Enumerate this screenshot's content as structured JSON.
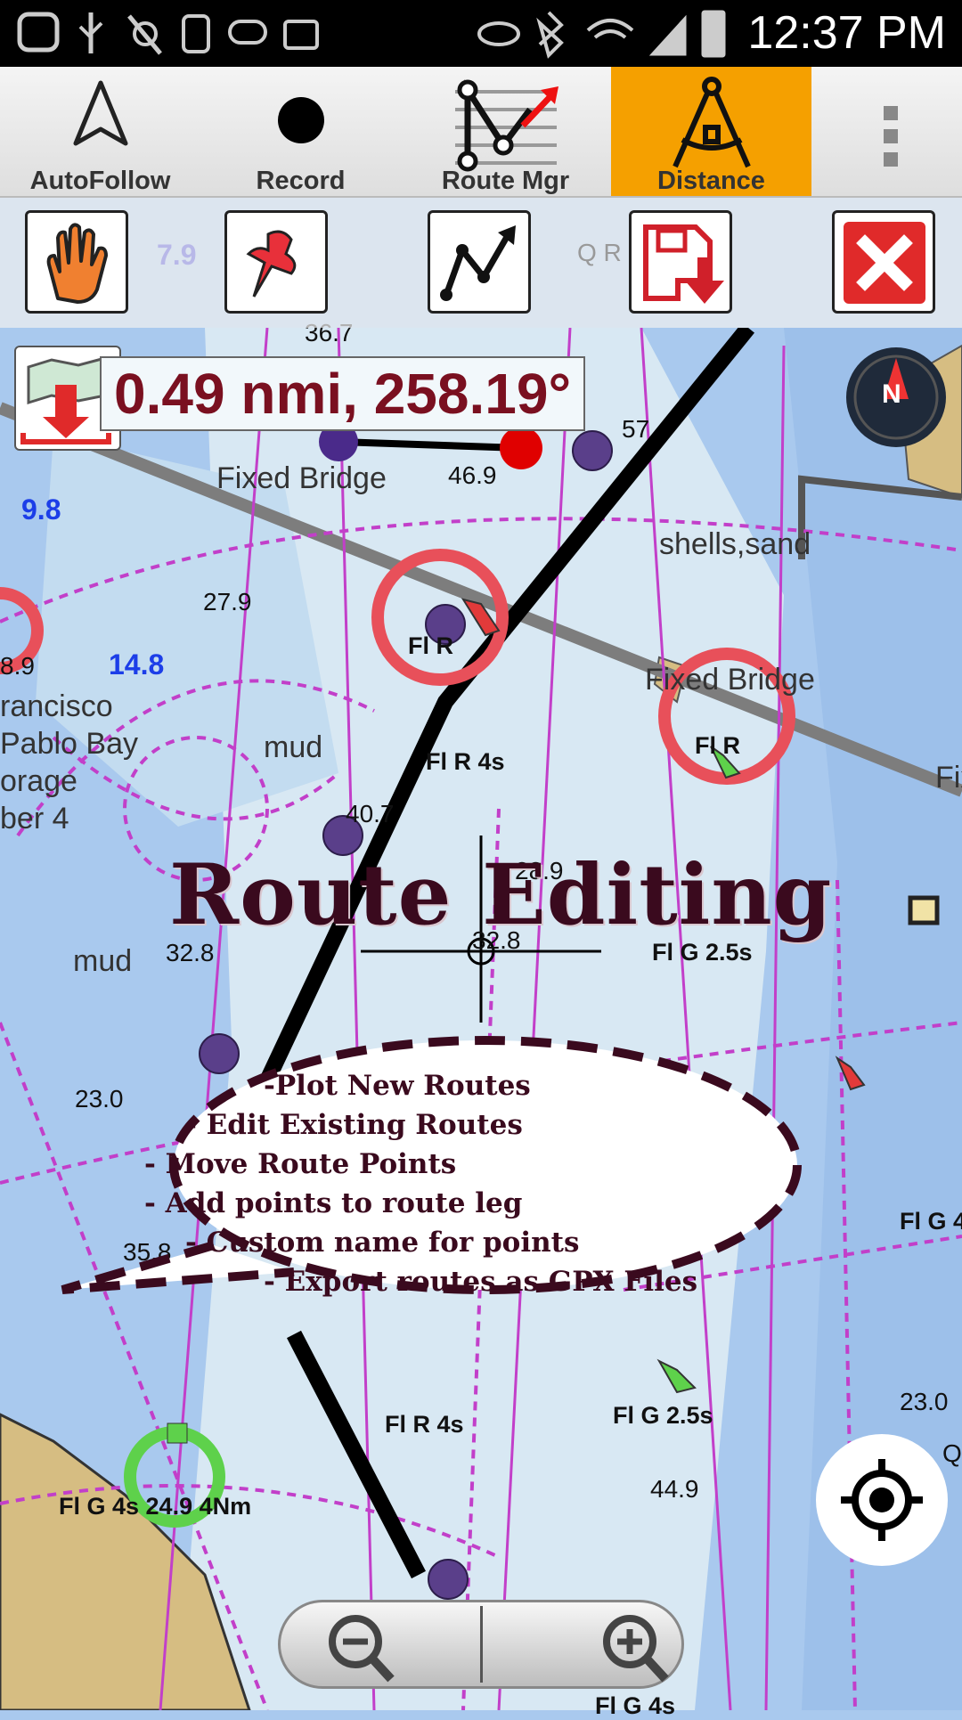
{
  "status_bar": {
    "time": "12:37 PM",
    "icons": [
      "messenger-icon",
      "usb-icon",
      "no-signal-icon",
      "watch-icon",
      "voicemail-icon",
      "briefcase-icon",
      "eye-icon",
      "bluetooth-icon",
      "wifi-icon",
      "cell-signal-icon",
      "battery-charging-icon"
    ]
  },
  "action_bar": {
    "items": [
      {
        "label": "AutoFollow",
        "icon": "navigation-arrow-icon"
      },
      {
        "label": "Record",
        "icon": "record-dot-icon"
      },
      {
        "label": "Route Mgr",
        "icon": "route-manager-icon"
      },
      {
        "label": "Distance",
        "icon": "compass-divider-icon",
        "active": true
      }
    ],
    "overflow_icon": "overflow-menu-icon"
  },
  "toolbar": {
    "buttons": [
      "hand-pan-icon",
      "pushpin-icon",
      "route-line-icon",
      "save-route-icon",
      "close-x-icon"
    ]
  },
  "map": {
    "distance_readout": "0.49 nmi, 258.19°",
    "title": "Route Editing",
    "bubble_lines": [
      "-Plot New Routes",
      "- Edit Existing Routes",
      "- Move Route Points",
      "- Add points to route leg",
      "- Custom name for points",
      "- Export routes as GPX Files"
    ],
    "labels": {
      "fixed_bridge_1": "Fixed Bridge",
      "fixed_bridge_2": "Fixed Bridge",
      "shells_sand": "shells,sand",
      "mud_1": "mud",
      "mud_2": "mud",
      "francisco": "rancisco",
      "pablo_bay": "Pablo Bay",
      "orage": "orage",
      "ber4": "ber 4",
      "fix": "Fix"
    },
    "depths": {
      "d36_7": "36.7",
      "d7_9": "7.9",
      "d57": "57",
      "d46_9": "46.9",
      "d27_9": "27.9",
      "d8_9": "8.9",
      "d40_7": "40.7",
      "d28_9": "28.9",
      "d32_8a": "32.8",
      "d32_8b": "32.8",
      "d23_0a": "23.0",
      "d35_8": "35.8",
      "d23_0b": "23.0",
      "d44_9": "44.9",
      "qr": "Q R",
      "q": "Q"
    },
    "blue_depths": {
      "b9_8": "9.8",
      "b14_8": "14.8"
    },
    "lights": {
      "flr1": "Fl R",
      "flr2": "Fl R",
      "flr4s_1": "Fl R 4s",
      "flg25s_1": "Fl G 2.5s",
      "flg25s_2": "Fl G 2.5s",
      "flr4s_2": "Fl R 4s",
      "flg4s": "Fl G 4s 24.9 4Nm",
      "flg4_edge": "Fl G 4",
      "flg4_bottom": "Fl G 4s"
    },
    "compass_letter": "N",
    "zoom_out_icon": "zoom-out-icon",
    "zoom_in_icon": "zoom-in-icon",
    "locate_icon": "my-location-icon"
  },
  "colors": {
    "accent": "#f5a000",
    "water": "#a9c9ee",
    "land": "#d6bd82",
    "route_magenta": "#c23fc9",
    "readout_text": "#7a1020"
  }
}
